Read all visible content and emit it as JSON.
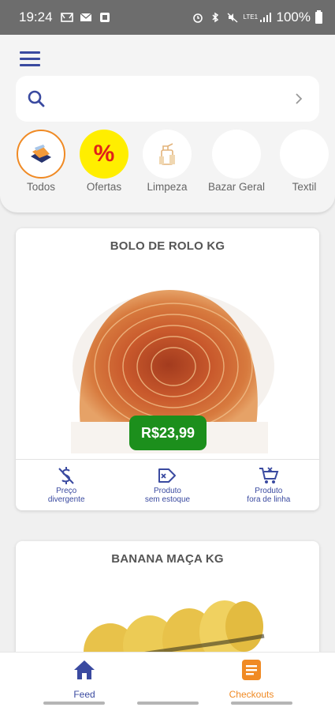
{
  "status_bar": {
    "time": "19:24",
    "battery": "100%",
    "network": "LTE1"
  },
  "header": {
    "menu_icon": "hamburger-menu-icon",
    "search": {
      "placeholder": "",
      "value": ""
    },
    "categories": [
      {
        "label": "Todos",
        "icon": "all-products-box-icon",
        "selected": true
      },
      {
        "label": "Ofertas",
        "icon": "percent-icon",
        "selected": false
      },
      {
        "label": "Limpeza",
        "icon": "cleaning-products-icon",
        "selected": false
      },
      {
        "label": "Bazar Geral",
        "icon": "",
        "selected": false
      },
      {
        "label": "Textil",
        "icon": "",
        "selected": false
      }
    ]
  },
  "products": [
    {
      "name": "BOLO DE ROLO KG",
      "price": "R$23,99",
      "image": "swiss-roll-cake-image",
      "actions": [
        {
          "label": "Preço\ndivergente",
          "icon": "dollar-strike-icon"
        },
        {
          "label": "Produto\nsem estoque",
          "icon": "tag-x-icon"
        },
        {
          "label": "Produto\nfora de linha",
          "icon": "cart-x-icon"
        }
      ]
    },
    {
      "name": "BANANA MAÇA KG",
      "image": "bananas-image"
    }
  ],
  "bottom_nav": [
    {
      "label": "Feed",
      "icon": "home-icon",
      "color": "#3a4aa0"
    },
    {
      "label": "Checkouts",
      "icon": "checklist-icon",
      "color": "#f08a24"
    }
  ],
  "colors": {
    "primary": "#3a4aa0",
    "price_green": "#1c8f1c",
    "accent_orange": "#f08a24",
    "offer_yellow": "#ffee00",
    "offer_red": "#e0201a"
  }
}
